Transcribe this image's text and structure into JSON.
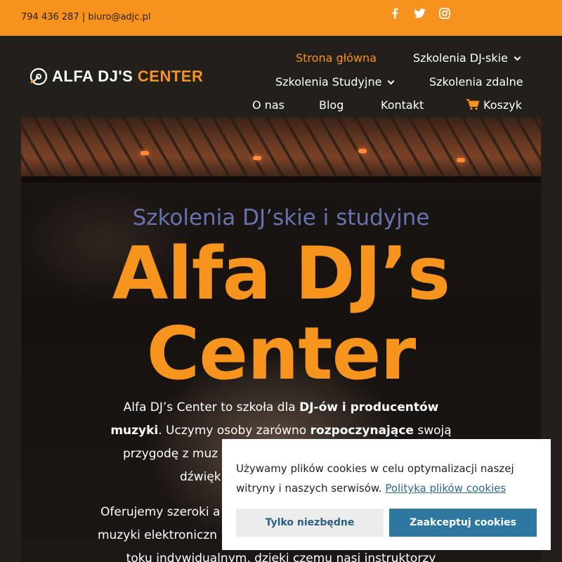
{
  "topbar": {
    "contact": "794 436 287 | biuro@adjc.pl",
    "social": [
      {
        "icon": "facebook-icon"
      },
      {
        "icon": "twitter-icon"
      },
      {
        "icon": "instagram-icon"
      }
    ]
  },
  "logo": {
    "white_part": "ALFA DJ'S",
    "orange_part": "CENTER"
  },
  "nav": {
    "home": "Strona główna",
    "dj_training": "Szkolenia DJ-skie",
    "studio_training": "Szkolenia Studyjne",
    "remote_training": "Szkolenia zdalne",
    "about": "O nas",
    "blog": "Blog",
    "contact": "Kontakt",
    "cart": "Koszyk"
  },
  "hero": {
    "subtitle": "Szkolenia DJ’skie i studyjne",
    "title_line1": "Alfa DJ’s",
    "title_line2": "Center",
    "p1": {
      "l1a": "Alfa DJ’s Center to szkoła dla ",
      "l1b": "DJ-ów i producentów",
      "l2a": "muzyki",
      "l2b": ". Uczymy osoby zarówno ",
      "l2c": "rozpoczynające",
      "l2d": " swoją",
      "l3": "przygodę z muz",
      "l4": "dźwięk"
    },
    "p2": {
      "l1": "Oferujemy szeroki a",
      "l2": "muzyki elektroniczn",
      "l3": "toku indywidualnym, dzięki czemu nasi instruktorzy"
    }
  },
  "cookie": {
    "text": "Używamy plików cookies w celu optymalizacji naszej witryny i naszych serwisów.",
    "link": "Polityka plików cookies",
    "decline": "Tylko niezbędne",
    "accept": "Zaakceptuj cookies"
  },
  "colors": {
    "accent": "#f7921e",
    "dark": "#23201c",
    "subtitle": "#6773b0",
    "button_blue": "#2d77a0"
  }
}
